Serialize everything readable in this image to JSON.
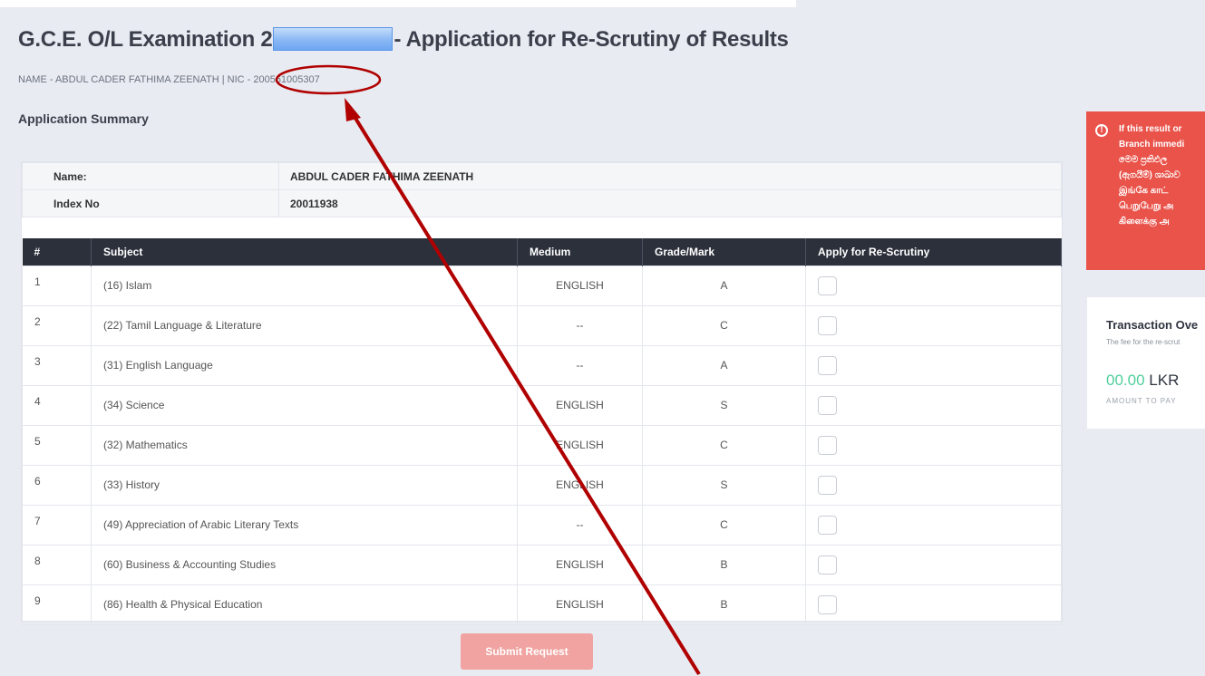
{
  "header": {
    "title_prefix": "G.C.E. O/L Examination 2",
    "title_suffix": "- Application for Re-Scrutiny of Results",
    "subline": "NAME - ABDUL CADER FATHIMA ZEENATH | NIC - 200561005307"
  },
  "summary": {
    "heading": "Application Summary",
    "name_label": "Name:",
    "name_value": "ABDUL CADER FATHIMA ZEENATH",
    "index_label": "Index No",
    "index_value": "20011938"
  },
  "table": {
    "headers": [
      "#",
      "Subject",
      "Medium",
      "Grade/Mark",
      "Apply for Re-Scrutiny"
    ],
    "rows": [
      {
        "num": "1",
        "subject": "(16) Islam",
        "medium": "ENGLISH",
        "grade": "A"
      },
      {
        "num": "2",
        "subject": "(22) Tamil Language & Literature",
        "medium": "--",
        "grade": "C"
      },
      {
        "num": "3",
        "subject": "(31) English Language",
        "medium": "--",
        "grade": "A"
      },
      {
        "num": "4",
        "subject": "(34) Science",
        "medium": "ENGLISH",
        "grade": "S"
      },
      {
        "num": "5",
        "subject": "(32) Mathematics",
        "medium": "ENGLISH",
        "grade": "C"
      },
      {
        "num": "6",
        "subject": "(33) History",
        "medium": "ENGLISH",
        "grade": "S"
      },
      {
        "num": "7",
        "subject": "(49) Appreciation of Arabic Literary Texts",
        "medium": "--",
        "grade": "C"
      },
      {
        "num": "8",
        "subject": "(60) Business & Accounting Studies",
        "medium": "ENGLISH",
        "grade": "B"
      },
      {
        "num": "9",
        "subject": "(86) Health & Physical Education",
        "medium": "ENGLISH",
        "grade": "B"
      }
    ]
  },
  "submit_label": "Submit Request",
  "alert": {
    "lines": [
      "If this result or",
      "Branch immedi",
      "මෙම ප්‍රතිඵල",
      "(ඇගයීම්) ශාඛාව",
      "இங்கே காட்",
      "பெறுபேறு அ",
      "கிளைக்கு அ"
    ]
  },
  "transaction": {
    "title": "Transaction Ove",
    "subtitle": "The fee for the re-scrut",
    "amount": "00.00",
    "currency": "LKR",
    "amount_label": "AMOUNT TO PAY"
  },
  "colors": {
    "alert_bg": "#e9534a",
    "header_bg": "#2b303b",
    "amount_green": "#4fcf9a",
    "submit_disabled": "#f0a3a0",
    "annotation_red": "#b00000"
  }
}
